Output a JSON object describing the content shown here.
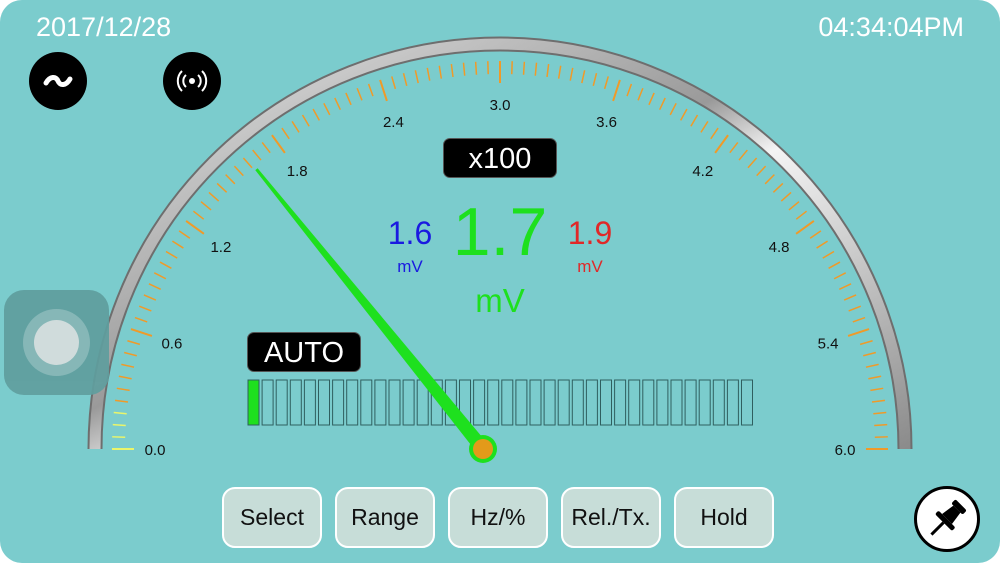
{
  "header": {
    "date": "2017/12/28",
    "time": "04:34:04PM"
  },
  "icons": {
    "ac_mode": "tilde-icon",
    "wireless": "wireless-signal-icon",
    "pin": "pushpin-icon",
    "assistive_touch": "assistive-touch-icon"
  },
  "gauge": {
    "scale_labels": [
      "0.0",
      "0.6",
      "1.2",
      "1.8",
      "2.4",
      "3.0",
      "3.6",
      "4.2",
      "4.8",
      "5.4",
      "6.0"
    ],
    "scale_min": 0,
    "scale_max": 6,
    "needle_value": 1.7,
    "multiplier": "x100",
    "range_mode": "AUTO",
    "bar_graph_fraction": 0.04
  },
  "reading": {
    "main_value": "1.7",
    "main_unit": "mV",
    "min_value": "1.6",
    "min_unit": "mV",
    "max_value": "1.9",
    "max_unit": "mV"
  },
  "colors": {
    "background": "#7bcccd",
    "needle": "#1ee01e",
    "min_text": "#1a1ae0",
    "max_text": "#e02828",
    "main_text": "#1ee01e",
    "tick": "#f09a28"
  },
  "controls": {
    "select": "Select",
    "range": "Range",
    "hz": "Hz/%",
    "rel": "Rel./Tx.",
    "hold": "Hold"
  }
}
